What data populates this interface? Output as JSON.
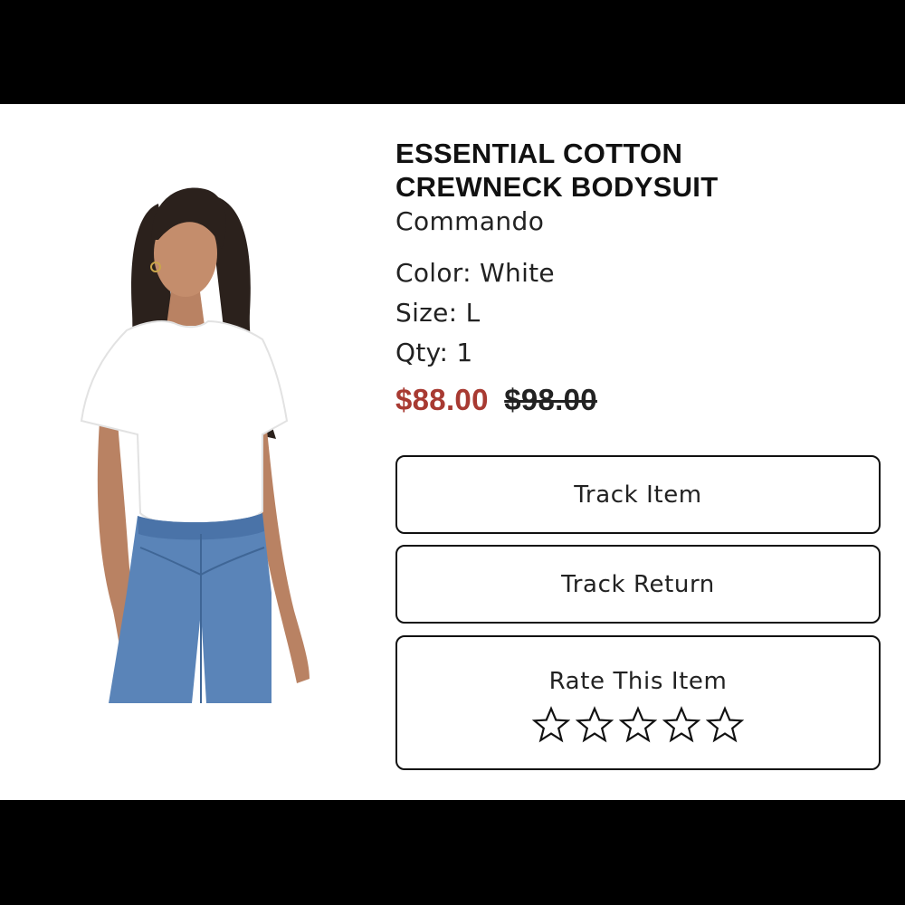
{
  "product": {
    "title_line1": "ESSENTIAL COTTON",
    "title_line2": "CREWNECK BODYSUIT",
    "brand": "Commando",
    "color_text": "Color: White",
    "size_text": "Size: L",
    "qty_text": "Qty: 1",
    "sale_price": "$88.00",
    "original_price": "$98.00"
  },
  "actions": {
    "track_item_label": "Track Item",
    "track_return_label": "Track Return",
    "rate_label": "Rate This Item"
  },
  "rating": {
    "max_stars": 5,
    "current": 0
  },
  "colors": {
    "sale_price": "#a83a32",
    "border": "#111111",
    "background": "#ffffff",
    "letterbox": "#000000"
  },
  "icons": {
    "star": "star-outline-icon"
  }
}
